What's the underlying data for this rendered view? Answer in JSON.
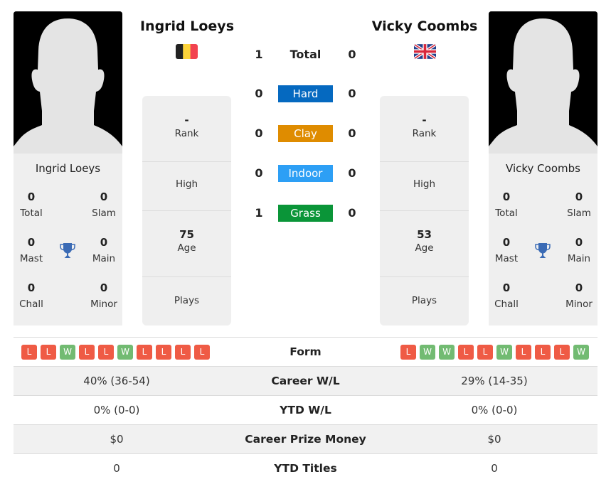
{
  "players": {
    "left": {
      "name": "Ingrid Loeys",
      "flag_icon": "belgium-flag-icon",
      "titles": {
        "total": "0",
        "slam": "0",
        "mast": "0",
        "main": "0",
        "chall": "0",
        "minor": "0"
      },
      "rank": "-",
      "high": "",
      "age": "75",
      "plays": "",
      "form": [
        "L",
        "L",
        "W",
        "L",
        "L",
        "W",
        "L",
        "L",
        "L",
        "L"
      ],
      "career_wl": "40% (36-54)",
      "ytd_wl": "0% (0-0)",
      "prize_money": "$0",
      "ytd_titles": "0"
    },
    "right": {
      "name": "Vicky Coombs",
      "flag_icon": "united-kingdom-flag-icon",
      "titles": {
        "total": "0",
        "slam": "0",
        "mast": "0",
        "main": "0",
        "chall": "0",
        "minor": "0"
      },
      "rank": "-",
      "high": "",
      "age": "53",
      "plays": "",
      "form": [
        "L",
        "W",
        "W",
        "L",
        "L",
        "W",
        "L",
        "L",
        "L",
        "W"
      ],
      "career_wl": "29% (14-35)",
      "ytd_wl": "0% (0-0)",
      "prize_money": "$0",
      "ytd_titles": "0"
    }
  },
  "labels": {
    "total": "Total",
    "slam": "Slam",
    "mast": "Mast",
    "main": "Main",
    "chall": "Chall",
    "minor": "Minor",
    "rank": "Rank",
    "high": "High",
    "age": "Age",
    "plays": "Plays",
    "form": "Form",
    "career_wl": "Career W/L",
    "ytd_wl": "YTD W/L",
    "prize_money": "Career Prize Money",
    "ytd_titles": "YTD Titles"
  },
  "h2h": {
    "total": {
      "label": "Total",
      "left": "1",
      "right": "0"
    },
    "surfaces": [
      {
        "label": "Hard",
        "left": "0",
        "right": "0",
        "color": "#0569c0"
      },
      {
        "label": "Clay",
        "left": "0",
        "right": "0",
        "color": "#df8c00"
      },
      {
        "label": "Indoor",
        "left": "0",
        "right": "0",
        "color": "#2d9ff5"
      },
      {
        "label": "Grass",
        "left": "1",
        "right": "0",
        "color": "#0a9538"
      }
    ]
  },
  "colors": {
    "loss": "#ef5b45",
    "win": "#72bb72",
    "trophy": "#3b6bb5"
  }
}
